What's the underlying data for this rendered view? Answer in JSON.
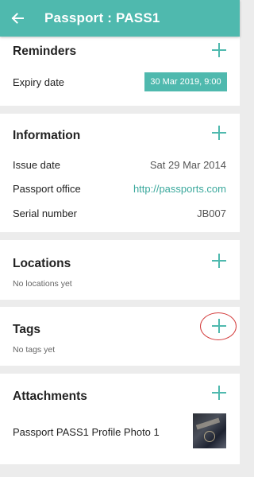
{
  "app_bar": {
    "title": "Passport : PASS1",
    "back_icon": "arrow-left-icon"
  },
  "colors": {
    "accent": "#4fb9ae",
    "highlight_circle": "#d33b3b"
  },
  "reminders": {
    "title": "Reminders",
    "items": [
      {
        "label": "Expiry date",
        "value": "30 Mar 2019, 9:00"
      }
    ]
  },
  "information": {
    "title": "Information",
    "rows": [
      {
        "label": "Issue date",
        "value": "Sat 29 Mar 2014"
      },
      {
        "label": "Passport office",
        "value": "http://passports.com"
      },
      {
        "label": "Serial number",
        "value": "JB007"
      }
    ]
  },
  "locations": {
    "title": "Locations",
    "empty_text": "No locations yet"
  },
  "tags": {
    "title": "Tags",
    "empty_text": "No tags yet"
  },
  "attachments": {
    "title": "Attachments",
    "items": [
      {
        "name": "Passport PASS1 Profile Photo 1"
      }
    ]
  }
}
